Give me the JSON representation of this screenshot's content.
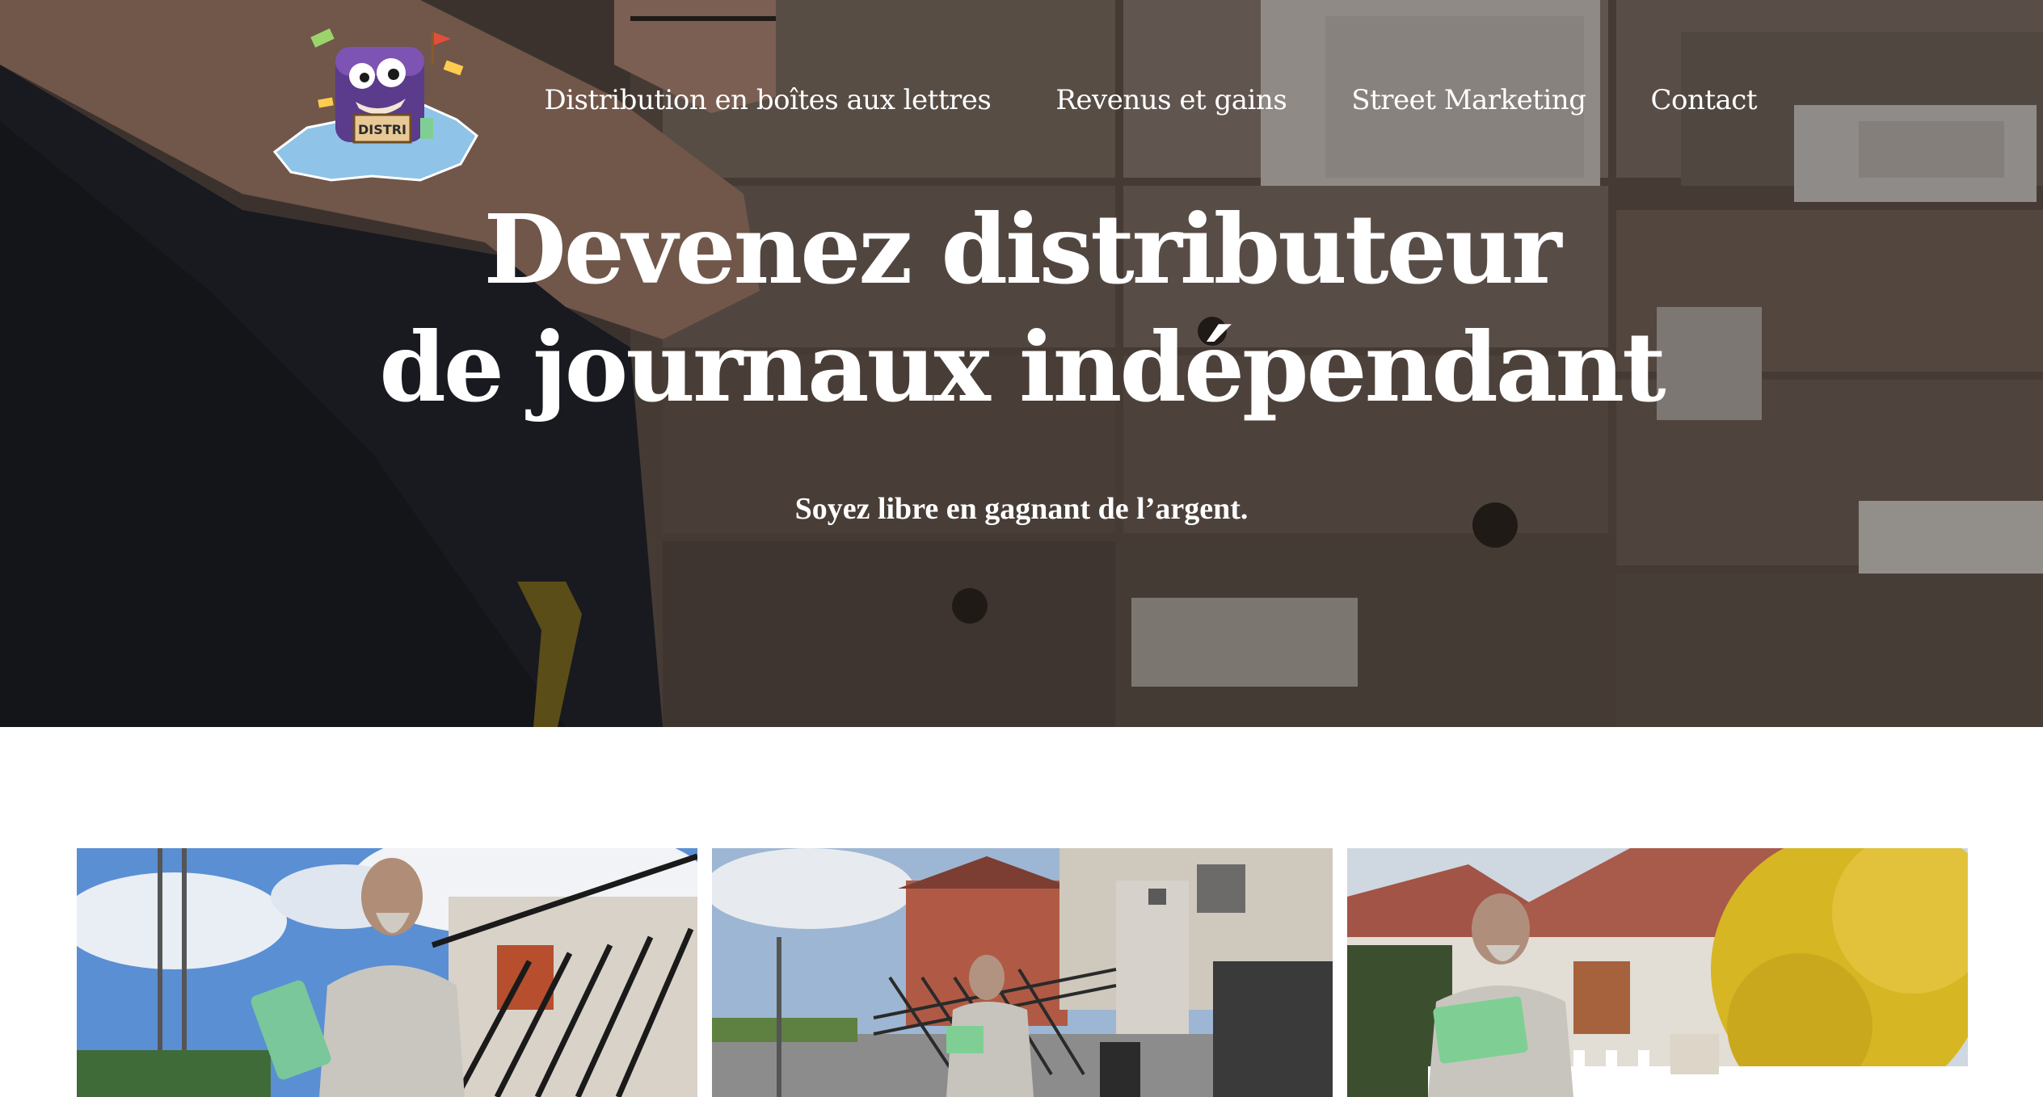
{
  "site": {
    "logo": {
      "text": "DISTRI",
      "icon": "mascot-mailbox-logo"
    }
  },
  "nav": {
    "items": [
      {
        "label": "Distribution en boîtes aux lettres"
      },
      {
        "label": "Revenus et gains"
      },
      {
        "label": "Street Marketing"
      },
      {
        "label": "Contact"
      }
    ]
  },
  "hero": {
    "title_line1": "Devenez distributeur",
    "title_line2": "de journaux indépendant",
    "subtitle": "Soyez libre en gagnant de l’argent."
  },
  "colors": {
    "hero_overlay": "#140e0c",
    "text_light": "#ffffff",
    "page_bg": "#ffffff",
    "flyer_green": "#7fcf95"
  }
}
